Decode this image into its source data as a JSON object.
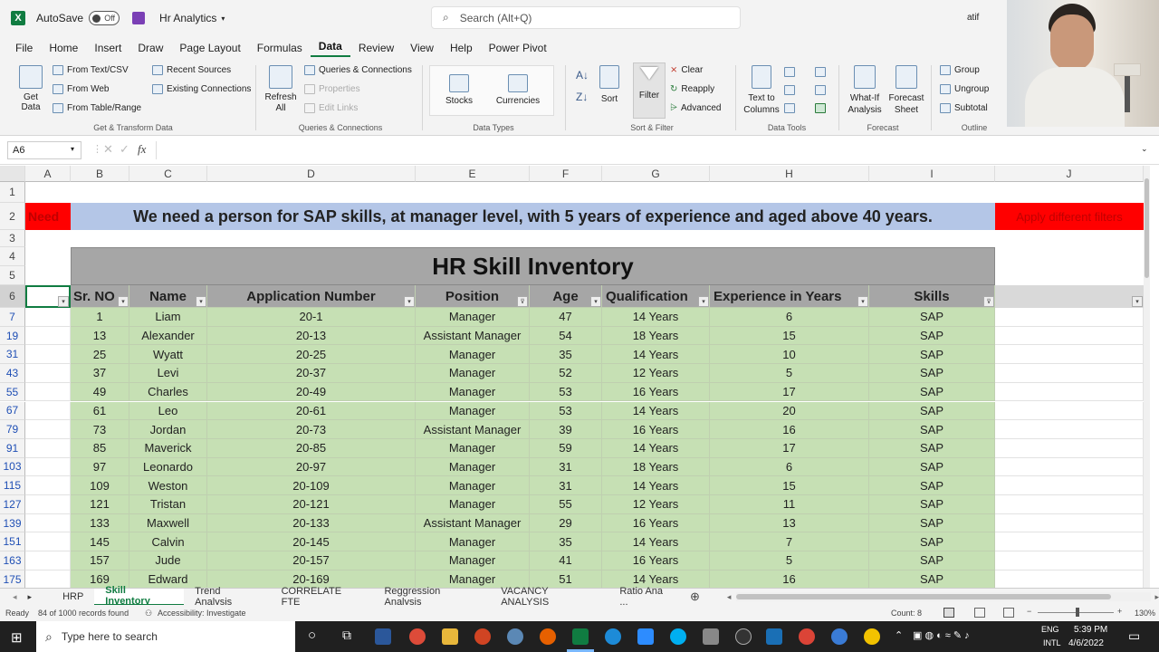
{
  "titlebar": {
    "app_icon": "X",
    "autosave_label": "AutoSave",
    "autosave_state": "Off",
    "save_icon": "save-icon",
    "file_name": "Hr Analytics",
    "search_placeholder": "Search (Alt+Q)",
    "user": "atif"
  },
  "menu": [
    "File",
    "Home",
    "Insert",
    "Draw",
    "Page Layout",
    "Formulas",
    "Data",
    "Review",
    "View",
    "Help",
    "Power Pivot"
  ],
  "ribbon": {
    "get_data": "Get Data",
    "from_text": "From Text/CSV",
    "from_web": "From Web",
    "from_table": "From Table/Range",
    "recent_sources": "Recent Sources",
    "existing_connections": "Existing Connections",
    "group_get": "Get & Transform Data",
    "refresh_all": "Refresh All",
    "queries_connections": "Queries & Connections",
    "properties": "Properties",
    "edit_links": "Edit Links",
    "group_queries": "Queries & Connections",
    "stocks": "Stocks",
    "currencies": "Currencies",
    "group_types": "Data Types",
    "sort": "Sort",
    "filter": "Filter",
    "clear": "Clear",
    "reapply": "Reapply",
    "advanced": "Advanced",
    "group_sort": "Sort & Filter",
    "text_to_columns": "Text to Columns",
    "group_tools": "Data Tools",
    "what_if": "What-If Analysis",
    "forecast_sheet": "Forecast Sheet",
    "group_forecast": "Forecast",
    "group_btn": "Group",
    "ungroup_btn": "Ungroup",
    "subtotal": "Subtotal",
    "group_outline": "Outline"
  },
  "formula_bar": {
    "name_box": "A6",
    "fx": "fx",
    "value": ""
  },
  "columns": [
    "A",
    "B",
    "C",
    "D",
    "E",
    "F",
    "G",
    "H",
    "I",
    "J"
  ],
  "sheet": {
    "need_label": "Need",
    "requirement": "We need a person for SAP skills, at manager level, with 5 years of experience and aged above 40 years.",
    "apply_filters": "Apply different filters",
    "title": "HR Skill Inventory",
    "headers": [
      "Sr. NO",
      "Name",
      "Application Number",
      "Position",
      "Age",
      "Qualification",
      "Experience in Years",
      "Skills"
    ],
    "row_numbers": [
      "1",
      "2",
      "3",
      "4",
      "5",
      "6"
    ],
    "rows": [
      {
        "r": "7",
        "sr": "1",
        "name": "Liam",
        "app": "20-1",
        "pos": "Manager",
        "age": "47",
        "qual": "14 Years",
        "exp": "6",
        "skill": "SAP"
      },
      {
        "r": "19",
        "sr": "13",
        "name": "Alexander",
        "app": "20-13",
        "pos": "Assistant Manager",
        "age": "54",
        "qual": "18 Years",
        "exp": "15",
        "skill": "SAP"
      },
      {
        "r": "31",
        "sr": "25",
        "name": "Wyatt",
        "app": "20-25",
        "pos": "Manager",
        "age": "35",
        "qual": "14 Years",
        "exp": "10",
        "skill": "SAP"
      },
      {
        "r": "43",
        "sr": "37",
        "name": "Levi",
        "app": "20-37",
        "pos": "Manager",
        "age": "52",
        "qual": "12 Years",
        "exp": "5",
        "skill": "SAP"
      },
      {
        "r": "55",
        "sr": "49",
        "name": "Charles",
        "app": "20-49",
        "pos": "Manager",
        "age": "53",
        "qual": "16 Years",
        "exp": "17",
        "skill": "SAP"
      },
      {
        "r": "67",
        "sr": "61",
        "name": "Leo",
        "app": "20-61",
        "pos": "Manager",
        "age": "53",
        "qual": "14 Years",
        "exp": "20",
        "skill": "SAP"
      },
      {
        "r": "79",
        "sr": "73",
        "name": "Jordan",
        "app": "20-73",
        "pos": "Assistant Manager",
        "age": "39",
        "qual": "16 Years",
        "exp": "16",
        "skill": "SAP"
      },
      {
        "r": "91",
        "sr": "85",
        "name": "Maverick",
        "app": "20-85",
        "pos": "Manager",
        "age": "59",
        "qual": "14 Years",
        "exp": "17",
        "skill": "SAP"
      },
      {
        "r": "103",
        "sr": "97",
        "name": "Leonardo",
        "app": "20-97",
        "pos": "Manager",
        "age": "31",
        "qual": "18 Years",
        "exp": "6",
        "skill": "SAP"
      },
      {
        "r": "115",
        "sr": "109",
        "name": "Weston",
        "app": "20-109",
        "pos": "Manager",
        "age": "31",
        "qual": "14 Years",
        "exp": "15",
        "skill": "SAP"
      },
      {
        "r": "127",
        "sr": "121",
        "name": "Tristan",
        "app": "20-121",
        "pos": "Manager",
        "age": "55",
        "qual": "12 Years",
        "exp": "11",
        "skill": "SAP"
      },
      {
        "r": "139",
        "sr": "133",
        "name": "Maxwell",
        "app": "20-133",
        "pos": "Assistant Manager",
        "age": "29",
        "qual": "16 Years",
        "exp": "13",
        "skill": "SAP"
      },
      {
        "r": "151",
        "sr": "145",
        "name": "Calvin",
        "app": "20-145",
        "pos": "Manager",
        "age": "35",
        "qual": "14 Years",
        "exp": "7",
        "skill": "SAP"
      },
      {
        "r": "163",
        "sr": "157",
        "name": "Jude",
        "app": "20-157",
        "pos": "Manager",
        "age": "41",
        "qual": "16 Years",
        "exp": "5",
        "skill": "SAP"
      },
      {
        "r": "175",
        "sr": "169",
        "name": "Edward",
        "app": "20-169",
        "pos": "Manager",
        "age": "51",
        "qual": "14 Years",
        "exp": "16",
        "skill": "SAP"
      }
    ]
  },
  "sheet_tabs": [
    "HRP",
    "Skill Inventory",
    "Trend Analysis",
    "CORRELATE FTE",
    "Reggression Analysis",
    "VACANCY ANALYSIS",
    "Ratio Ana ..."
  ],
  "active_tab": "Skill Inventory",
  "status": {
    "ready": "Ready",
    "records": "84 of 1000 records found",
    "accessibility": "Accessibility: Investigate",
    "count": "Count: 8",
    "zoom": "130%"
  },
  "taskbar": {
    "search": "Type here to search",
    "lang": "ENG",
    "lang2": "INTL",
    "time": "5:39 PM",
    "date": "4/6/2022"
  },
  "colors": {
    "excel_green": "#107c41",
    "need_red": "#ff0000",
    "requirement_blue": "#b4c6e7",
    "title_gray": "#a6a6a6",
    "row_green": "#c6e0b4"
  }
}
